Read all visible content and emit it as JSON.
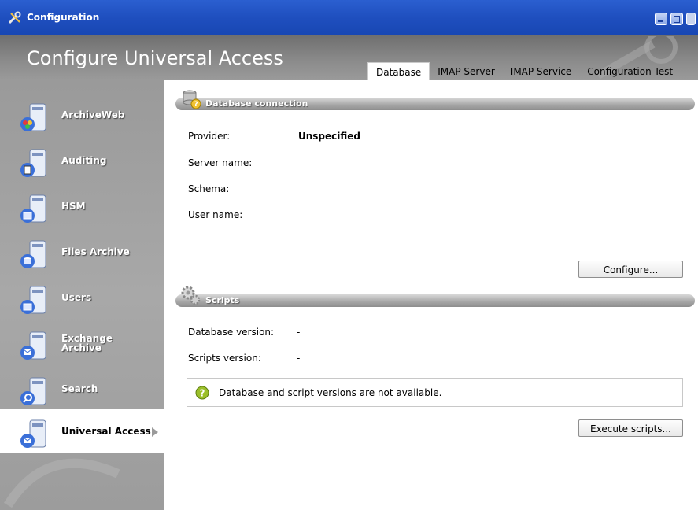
{
  "window": {
    "title": "Configuration",
    "main_title": "Configure Universal Access"
  },
  "tabs": [
    {
      "label": "Database",
      "active": true
    },
    {
      "label": "IMAP Server",
      "active": false
    },
    {
      "label": "IMAP Service",
      "active": false
    },
    {
      "label": "Configuration Test",
      "active": false
    }
  ],
  "sidebar": {
    "items": [
      {
        "label": "ArchiveWeb",
        "icon": "archiveweb-icon"
      },
      {
        "label": "Auditing",
        "icon": "auditing-icon"
      },
      {
        "label": "HSM",
        "icon": "hsm-icon"
      },
      {
        "label": "Files Archive",
        "icon": "files-archive-icon"
      },
      {
        "label": "Users",
        "icon": "users-icon"
      },
      {
        "label": "Exchange Archive",
        "icon": "exchange-archive-icon"
      },
      {
        "label": "Search",
        "icon": "search-icon"
      },
      {
        "label": "Universal Access",
        "icon": "universal-access-icon",
        "active": true
      }
    ]
  },
  "database": {
    "section_title": "Database connection",
    "provider_label": "Provider:",
    "provider_value": "Unspecified",
    "server_label": "Server name:",
    "schema_label": "Schema:",
    "user_label": "User name:",
    "configure_button": "Configure..."
  },
  "scripts": {
    "section_title": "Scripts",
    "db_version_label": "Database version:",
    "db_version_value": "-",
    "scripts_version_label": "Scripts version:",
    "scripts_version_value": "-",
    "info_message": "Database and script versions are not available.",
    "execute_button": "Execute scripts..."
  },
  "colors": {
    "titlebar": "#1f4fbf",
    "sidebar": "#a3a3a3",
    "section_bar": "#a9a9a9"
  }
}
